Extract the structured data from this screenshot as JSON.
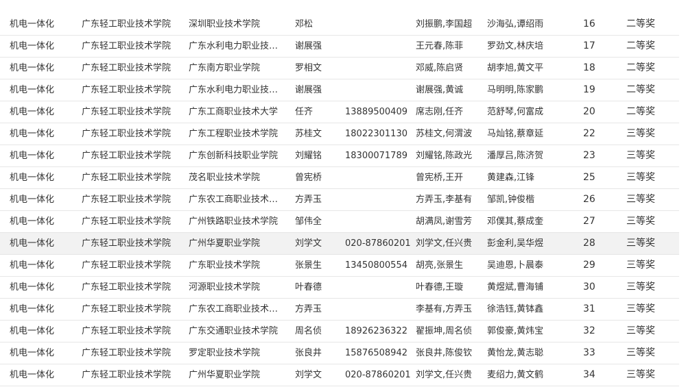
{
  "table": {
    "rows": [
      [
        "机电一体化",
        "广东轻工职业技术学院",
        "深圳职业技术学院",
        "邓松",
        "",
        "刘振鹏,李国超",
        "沙海弘,谭绍雨",
        "16",
        "二等奖"
      ],
      [
        "机电一体化",
        "广东轻工职业技术学院",
        "广东水利电力职业技术...",
        "谢展强",
        "",
        "王元春,陈菲",
        "罗劲文,林庆培",
        "17",
        "二等奖"
      ],
      [
        "机电一体化",
        "广东轻工职业技术学院",
        "广东南方职业学院",
        "罗相文",
        "",
        "邓威,陈启贤",
        "胡李旭,黄文平",
        "18",
        "二等奖"
      ],
      [
        "机电一体化",
        "广东轻工职业技术学院",
        "广东水利电力职业技术...",
        "谢展强",
        "",
        "谢展强,黄诚",
        "马明明,陈家鹏",
        "19",
        "二等奖"
      ],
      [
        "机电一体化",
        "广东轻工职业技术学院",
        "广东工商职业技术大学",
        "任齐",
        "13889500409",
        "席志刚,任齐",
        "范舒琴,何富成",
        "20",
        "二等奖"
      ],
      [
        "机电一体化",
        "广东轻工职业技术学院",
        "广东工程职业技术学院",
        "苏桂文",
        "18022301130",
        "苏桂文,何渭波",
        "马灿铭,蔡章延",
        "22",
        "三等奖"
      ],
      [
        "机电一体化",
        "广东轻工职业技术学院",
        "广东创新科技职业学院",
        "刘耀铭",
        "18300071789",
        "刘耀铭,陈政光",
        "潘厚吕,陈济贺",
        "23",
        "三等奖"
      ],
      [
        "机电一体化",
        "广东轻工职业技术学院",
        "茂名职业技术学院",
        "曾宪桥",
        "",
        "曾宪桥,王开",
        "黄建森,江锋",
        "25",
        "三等奖"
      ],
      [
        "机电一体化",
        "广东轻工职业技术学院",
        "广东农工商职业技术学院",
        "方弄玉",
        "",
        "方弄玉,李基有",
        "邹凯,钟俊楷",
        "26",
        "三等奖"
      ],
      [
        "机电一体化",
        "广东轻工职业技术学院",
        "广州铁路职业技术学院",
        "邹伟全",
        "",
        "胡满凤,谢雪芳",
        "邓僕其,蔡成奎",
        "27",
        "三等奖"
      ],
      [
        "机电一体化",
        "广东轻工职业技术学院",
        "广州华夏职业学院",
        "刘学文",
        "020-87860201",
        "刘学文,任兴贵",
        "彭金利,吴华煜",
        "28",
        "三等奖"
      ],
      [
        "机电一体化",
        "广东轻工职业技术学院",
        "广东职业技术学院",
        "张景生",
        "13450800554",
        "胡亮,张景生",
        "吴迪恩,卜晨泰",
        "29",
        "三等奖"
      ],
      [
        "机电一体化",
        "广东轻工职业技术学院",
        "河源职业技术学院",
        "叶春德",
        "",
        "叶春德,王璇",
        "黄煜斌,曹海铺",
        "30",
        "三等奖"
      ],
      [
        "机电一体化",
        "广东轻工职业技术学院",
        "广东农工商职业技术学院",
        "方弄玉",
        "",
        "李基有,方弄玉",
        "徐浩钰,黄钵鑫",
        "31",
        "三等奖"
      ],
      [
        "机电一体化",
        "广东轻工职业技术学院",
        "广东交通职业技术学院",
        "周名侦",
        "18926236322",
        "翟振坤,周名侦",
        "郭俊豪,黄炜宝",
        "32",
        "三等奖"
      ],
      [
        "机电一体化",
        "广东轻工职业技术学院",
        "罗定职业技术学院",
        "张良井",
        "15876508942",
        "张良井,陈俊钦",
        "黄怡龙,黄志聪",
        "33",
        "三等奖"
      ],
      [
        "机电一体化",
        "广东轻工职业技术学院",
        "广州华夏职业学院",
        "刘学文",
        "020-87860201",
        "刘学文,任兴贵",
        "麦绍力,黄文鹤",
        "34",
        "三等奖"
      ]
    ],
    "highlighted_row": 10
  }
}
